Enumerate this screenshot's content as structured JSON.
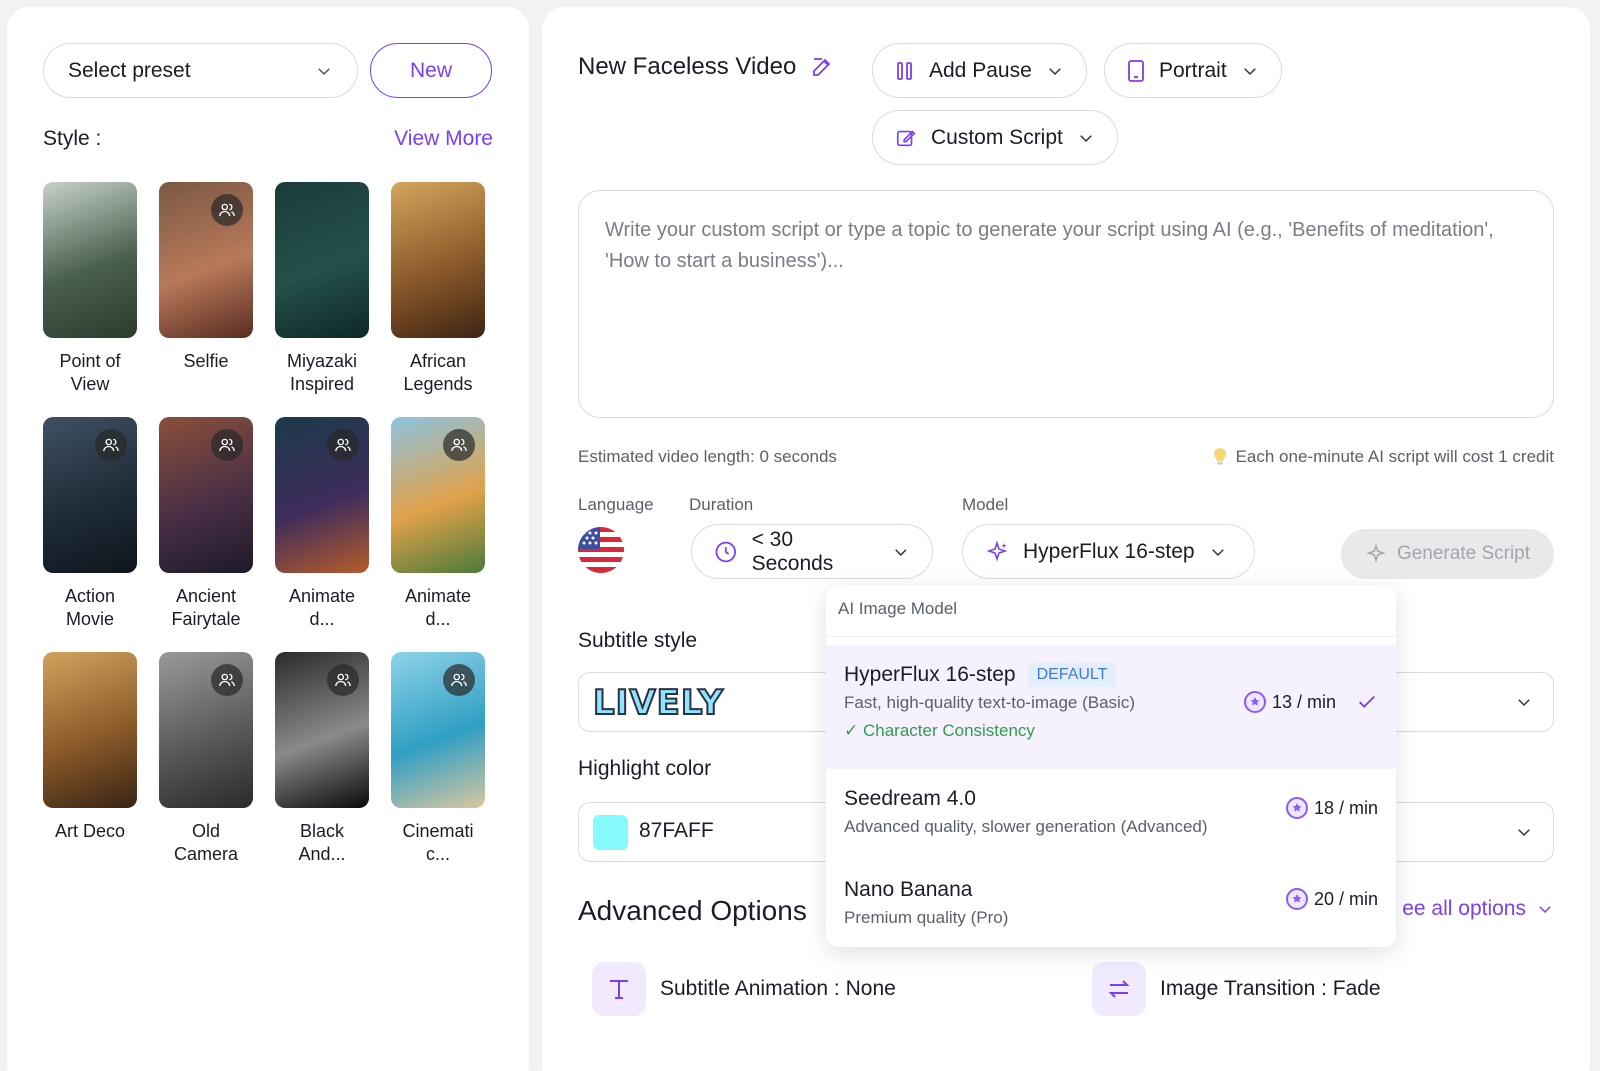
{
  "left": {
    "preset_placeholder": "Select preset",
    "new_label": "New",
    "style_label": "Style :",
    "view_more_label": "View More",
    "styles": [
      {
        "name": "Point of View",
        "icon": "",
        "colors": [
          "#c7d1c9",
          "#49604f",
          "#2d3a2d"
        ]
      },
      {
        "name": "Selfie",
        "icon": "group-icon",
        "colors": [
          "#7b5843",
          "#b8795a",
          "#5a2d22"
        ]
      },
      {
        "name": "Miyazaki Inspired",
        "icon": "",
        "colors": [
          "#1b3b3b",
          "#24514a",
          "#0f2628"
        ]
      },
      {
        "name": "African Legends",
        "icon": "",
        "colors": [
          "#d4a55c",
          "#8b5a2b",
          "#3f2414"
        ]
      },
      {
        "name": "Action Movie",
        "icon": "group-icon",
        "colors": [
          "#3e5163",
          "#1f2c38",
          "#0e151c"
        ]
      },
      {
        "name": "Ancient Fairytale",
        "icon": "group-icon",
        "colors": [
          "#8a4f3a",
          "#4a2f45",
          "#1c1a2a"
        ]
      },
      {
        "name": "Animate d...",
        "icon": "group-icon",
        "colors": [
          "#1b3a4a",
          "#3e2c5c",
          "#b65c2a"
        ]
      },
      {
        "name": "Animate d...",
        "icon": "group-icon",
        "colors": [
          "#8cc3e0",
          "#e0a24a",
          "#4a7a3a"
        ]
      },
      {
        "name": "Art Deco",
        "icon": "",
        "colors": [
          "#d4a25c",
          "#8a5a2a",
          "#3a2414"
        ]
      },
      {
        "name": "Old Camera",
        "icon": "group-icon",
        "colors": [
          "#9a9a9a",
          "#5a5a5a",
          "#2a2a2a"
        ]
      },
      {
        "name": "Black And...",
        "icon": "group-icon",
        "colors": [
          "#2a2a2a",
          "#8a8a8a",
          "#0a0a0a"
        ]
      },
      {
        "name": "Cinemati c...",
        "icon": "group-icon",
        "colors": [
          "#8fd3e8",
          "#2f9fc4",
          "#d9c7a0"
        ]
      }
    ]
  },
  "right": {
    "title": "New Faceless Video",
    "add_pause": "Add Pause",
    "orientation": "Portrait",
    "script_mode": "Custom Script",
    "script_placeholder": "Write your custom script or type a topic to generate your script using AI (e.g., 'Benefits of meditation', 'How to start a business')...",
    "estimated_length": "Estimated video length: 0 seconds",
    "cost_note": "Each one-minute AI script will cost 1 credit",
    "language_label": "Language",
    "duration_label": "Duration",
    "duration_value": "< 30 Seconds",
    "model_label": "Model",
    "model_value": "HyperFlux 16-step",
    "generate_label": "Generate Script",
    "subtitle_style_label": "Subtitle style",
    "subtitle_style_value": "LIVELY",
    "highlight_color_label": "Highlight color",
    "highlight_color_value": "87FAFF",
    "highlight_color_hex": "#87faff",
    "advanced_title": "Advanced Options",
    "see_all_label": "ee all options",
    "subtitle_animation": "Subtitle Animation : None",
    "image_transition": "Image Transition : Fade"
  },
  "dropdown": {
    "header": "AI Image Model",
    "items": [
      {
        "name": "HyperFlux 16-step",
        "badge": "DEFAULT",
        "desc": "Fast, high-quality text-to-image (Basic)",
        "feature": "✓ Character Consistency",
        "cost": "13 / min",
        "selected": true
      },
      {
        "name": "Seedream 4.0",
        "desc": "Advanced quality, slower generation (Advanced)",
        "cost": "18 / min",
        "selected": false
      },
      {
        "name": "Nano Banana",
        "desc": "Premium quality (Pro)",
        "cost": "20 / min",
        "selected": false
      }
    ]
  },
  "colors": {
    "accent": "#7b3ff2",
    "success": "#2e9e4a"
  }
}
